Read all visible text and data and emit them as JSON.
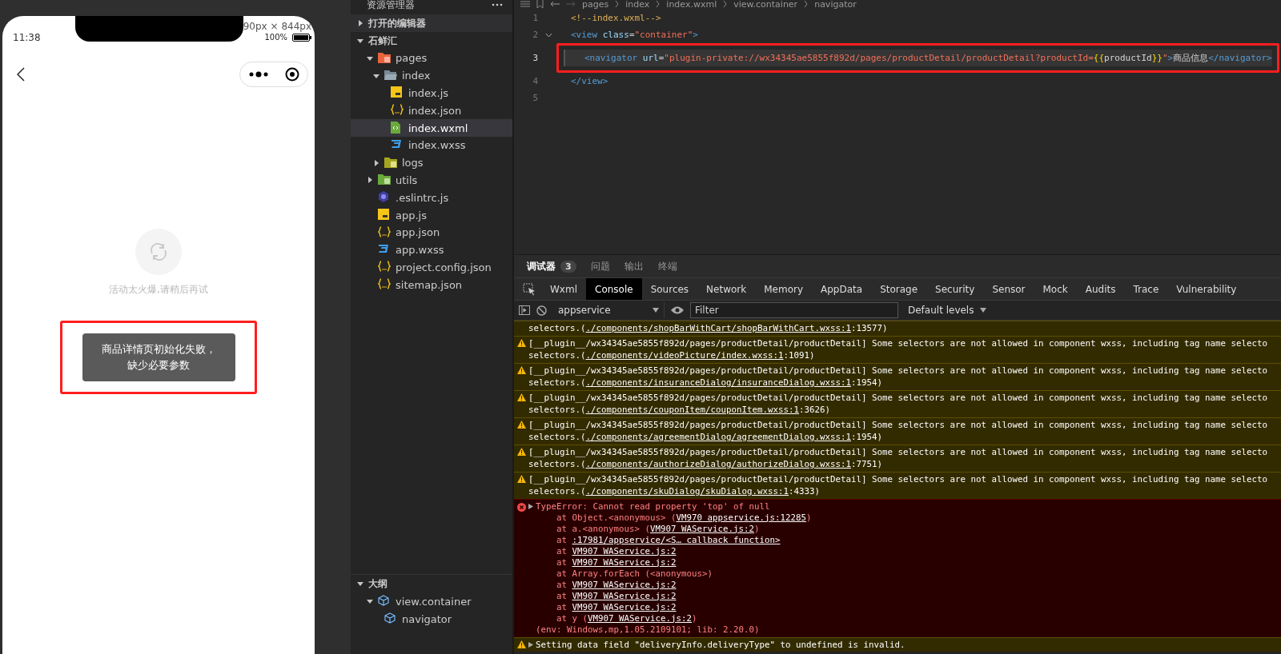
{
  "phone": {
    "time": "11:38",
    "size_label": "90px × 844px",
    "battery_label": "100%",
    "empty_message": "活动太火爆,请稍后再试",
    "toast": {
      "text": "商品详情页初始化失败，缺少必要参数",
      "marked": true
    }
  },
  "explorer": {
    "title": "资源管理器",
    "sections": [
      {
        "label": "打开的编辑器",
        "expanded": false
      },
      {
        "label": "石鲜汇",
        "expanded": true
      }
    ],
    "tree": [
      {
        "label": "pages",
        "kind": "folder-pages",
        "expanded": true,
        "selected": false,
        "children": [
          {
            "label": "index",
            "kind": "folder-open",
            "expanded": true,
            "selected": false,
            "children": [
              {
                "label": "index.js",
                "kind": "js",
                "selected": false
              },
              {
                "label": "index.json",
                "kind": "json",
                "selected": false
              },
              {
                "label": "index.wxml",
                "kind": "wxml",
                "selected": true
              },
              {
                "label": "index.wxss",
                "kind": "wxss",
                "selected": false
              }
            ]
          },
          {
            "label": "logs",
            "kind": "folder-logs",
            "expanded": false,
            "selected": false
          }
        ]
      },
      {
        "label": "utils",
        "kind": "folder-utils",
        "expanded": false,
        "selected": false
      },
      {
        "label": ".eslintrc.js",
        "kind": "eslint",
        "selected": false
      },
      {
        "label": "app.js",
        "kind": "js",
        "selected": false
      },
      {
        "label": "app.json",
        "kind": "json",
        "selected": false
      },
      {
        "label": "app.wxss",
        "kind": "wxss",
        "selected": false
      },
      {
        "label": "project.config.json",
        "kind": "json",
        "selected": false
      },
      {
        "label": "sitemap.json",
        "kind": "json",
        "selected": false
      }
    ],
    "outline": {
      "label": "大纲",
      "expanded": true,
      "tree": [
        {
          "label": "view.container",
          "kind": "cube",
          "expanded": true,
          "selected": false,
          "children": [
            {
              "label": "navigator",
              "kind": "cube",
              "selected": false
            }
          ]
        }
      ]
    }
  },
  "editor": {
    "breadcrumb": [
      "pages",
      "index",
      "index.wxml",
      "view.container",
      "navigator"
    ],
    "lines": [
      {
        "number": "1",
        "current": false,
        "tokens": [
          {
            "kind": "comment",
            "t": "<!--index.wxml-->"
          }
        ]
      },
      {
        "number": "2",
        "current": false,
        "foldable": true,
        "tokens": [
          {
            "kind": "tag",
            "t": "<view"
          },
          {
            "kind": "attr",
            "t": " class"
          },
          {
            "kind": "text",
            "t": "="
          },
          {
            "kind": "string",
            "t": "\"container\""
          },
          {
            "kind": "tag",
            "t": ">"
          }
        ]
      },
      {
        "number": "3",
        "current": true,
        "marked": true,
        "tokens": [
          {
            "kind": "tag",
            "t": "<navigator"
          },
          {
            "kind": "attr",
            "t": " url"
          },
          {
            "kind": "text",
            "t": "="
          },
          {
            "kind": "string",
            "t": "\"plugin-private://wx34345ae5855f892d/pages/productDetail/productDetail?productId="
          },
          {
            "kind": "brace",
            "t": "{{"
          },
          {
            "kind": "text",
            "t": "productId"
          },
          {
            "kind": "brace",
            "t": "}}"
          },
          {
            "kind": "string",
            "t": "\""
          },
          {
            "kind": "tag",
            "t": ">"
          },
          {
            "kind": "text",
            "t": "商品信息"
          },
          {
            "kind": "tag",
            "t": "</navigator>"
          }
        ]
      },
      {
        "number": "4",
        "current": false,
        "tokens": [
          {
            "kind": "tag",
            "t": "</view>"
          }
        ]
      },
      {
        "number": "5",
        "current": false
      }
    ]
  },
  "console": {
    "panel_tabs": [
      {
        "label": "调试器",
        "badge": "3",
        "selected": true
      },
      {
        "label": "问题",
        "selected": false
      },
      {
        "label": "输出",
        "selected": false
      },
      {
        "label": "终端",
        "selected": false
      }
    ],
    "devtools_tabs": [
      {
        "label": "Wxml",
        "selected": false
      },
      {
        "label": "Console",
        "selected": true
      },
      {
        "label": "Sources",
        "selected": false
      },
      {
        "label": "Network",
        "selected": false
      },
      {
        "label": "Memory",
        "selected": false
      },
      {
        "label": "AppData",
        "selected": false
      },
      {
        "label": "Storage",
        "selected": false
      },
      {
        "label": "Security",
        "selected": false
      },
      {
        "label": "Sensor",
        "selected": false
      },
      {
        "label": "Mock",
        "selected": false
      },
      {
        "label": "Audits",
        "selected": false
      },
      {
        "label": "Trace",
        "selected": false
      },
      {
        "label": "Vulnerability",
        "selected": false
      }
    ],
    "context": "appservice",
    "filter_placeholder": "Filter",
    "levels": "Default levels",
    "messages": [
      {
        "kind": "continuation",
        "lines": [
          [
            {
              "t": "selectors.("
            },
            {
              "t": "./components/shopBarWithCart/shopBarWithCart.wxss:1",
              "link": true
            },
            {
              "t": ":13577)"
            }
          ]
        ]
      },
      {
        "kind": "warning",
        "lines": [
          [
            {
              "t": "[__plugin__/wx34345ae5855f892d/pages/productDetail/productDetail] Some selectors are not allowed in component wxss, including tag name selecto"
            }
          ],
          [
            {
              "t": "selectors.("
            },
            {
              "t": "./components/videoPicture/index.wxss:1",
              "link": true
            },
            {
              "t": ":1091)"
            }
          ]
        ]
      },
      {
        "kind": "warning",
        "lines": [
          [
            {
              "t": "[__plugin__/wx34345ae5855f892d/pages/productDetail/productDetail] Some selectors are not allowed in component wxss, including tag name selecto"
            }
          ],
          [
            {
              "t": "selectors.("
            },
            {
              "t": "./components/insuranceDialog/insuranceDialog.wxss:1",
              "link": true
            },
            {
              "t": ":1954)"
            }
          ]
        ]
      },
      {
        "kind": "warning",
        "lines": [
          [
            {
              "t": "[__plugin__/wx34345ae5855f892d/pages/productDetail/productDetail] Some selectors are not allowed in component wxss, including tag name selecto"
            }
          ],
          [
            {
              "t": "selectors.("
            },
            {
              "t": "./components/couponItem/couponItem.wxss:1",
              "link": true
            },
            {
              "t": ":3626)"
            }
          ]
        ]
      },
      {
        "kind": "warning",
        "lines": [
          [
            {
              "t": "[__plugin__/wx34345ae5855f892d/pages/productDetail/productDetail] Some selectors are not allowed in component wxss, including tag name selecto"
            }
          ],
          [
            {
              "t": "selectors.("
            },
            {
              "t": "./components/agreementDialog/agreementDialog.wxss:1",
              "link": true
            },
            {
              "t": ":1954)"
            }
          ]
        ]
      },
      {
        "kind": "warning",
        "lines": [
          [
            {
              "t": "[__plugin__/wx34345ae5855f892d/pages/productDetail/productDetail] Some selectors are not allowed in component wxss, including tag name selecto"
            }
          ],
          [
            {
              "t": "selectors.("
            },
            {
              "t": "./components/authorizeDialog/authorizeDialog.wxss:1",
              "link": true
            },
            {
              "t": ":7751)"
            }
          ]
        ]
      },
      {
        "kind": "warning",
        "lines": [
          [
            {
              "t": "[__plugin__/wx34345ae5855f892d/pages/productDetail/productDetail] Some selectors are not allowed in component wxss, including tag name selecto"
            }
          ],
          [
            {
              "t": "selectors.("
            },
            {
              "t": "./components/skuDialog/skuDialog.wxss:1",
              "link": true
            },
            {
              "t": ":4333)"
            }
          ]
        ]
      },
      {
        "kind": "error",
        "expandable": true,
        "lines": [
          [
            {
              "t": "TypeError: Cannot read property 'top' of null"
            }
          ],
          [
            {
              "t": "    at Object.<anonymous> ("
            },
            {
              "t": "VM970 appservice.js:12285",
              "link": true
            },
            {
              "t": ")"
            }
          ],
          [
            {
              "t": "    at a.<anonymous> ("
            },
            {
              "t": "VM907 WAService.js:2",
              "link": true
            },
            {
              "t": ")"
            }
          ],
          [
            {
              "t": "    at "
            },
            {
              "t": ":17981/appservice/<S… callback function>",
              "link": true
            }
          ],
          [
            {
              "t": "    at "
            },
            {
              "t": "VM907 WAService.js:2",
              "link": true
            }
          ],
          [
            {
              "t": "    at "
            },
            {
              "t": "VM907 WAService.js:2",
              "link": true
            }
          ],
          [
            {
              "t": "    at Array.forEach (<anonymous>)"
            }
          ],
          [
            {
              "t": "    at "
            },
            {
              "t": "VM907 WAService.js:2",
              "link": true
            }
          ],
          [
            {
              "t": "    at "
            },
            {
              "t": "VM907 WAService.js:2",
              "link": true
            }
          ],
          [
            {
              "t": "    at "
            },
            {
              "t": "VM907 WAService.js:2",
              "link": true
            }
          ],
          [
            {
              "t": "    at y ("
            },
            {
              "t": "VM907 WAService.js:2",
              "link": true
            },
            {
              "t": ")"
            }
          ],
          [
            {
              "t": "(env: Windows,mp,1.05.2109101; lib: 2.20.0)"
            }
          ]
        ]
      },
      {
        "kind": "warning",
        "expandable": true,
        "lines": [
          [
            {
              "t": "Setting data field \"deliveryInfo.deliveryType\" to undefined is invalid."
            }
          ]
        ]
      }
    ]
  }
}
